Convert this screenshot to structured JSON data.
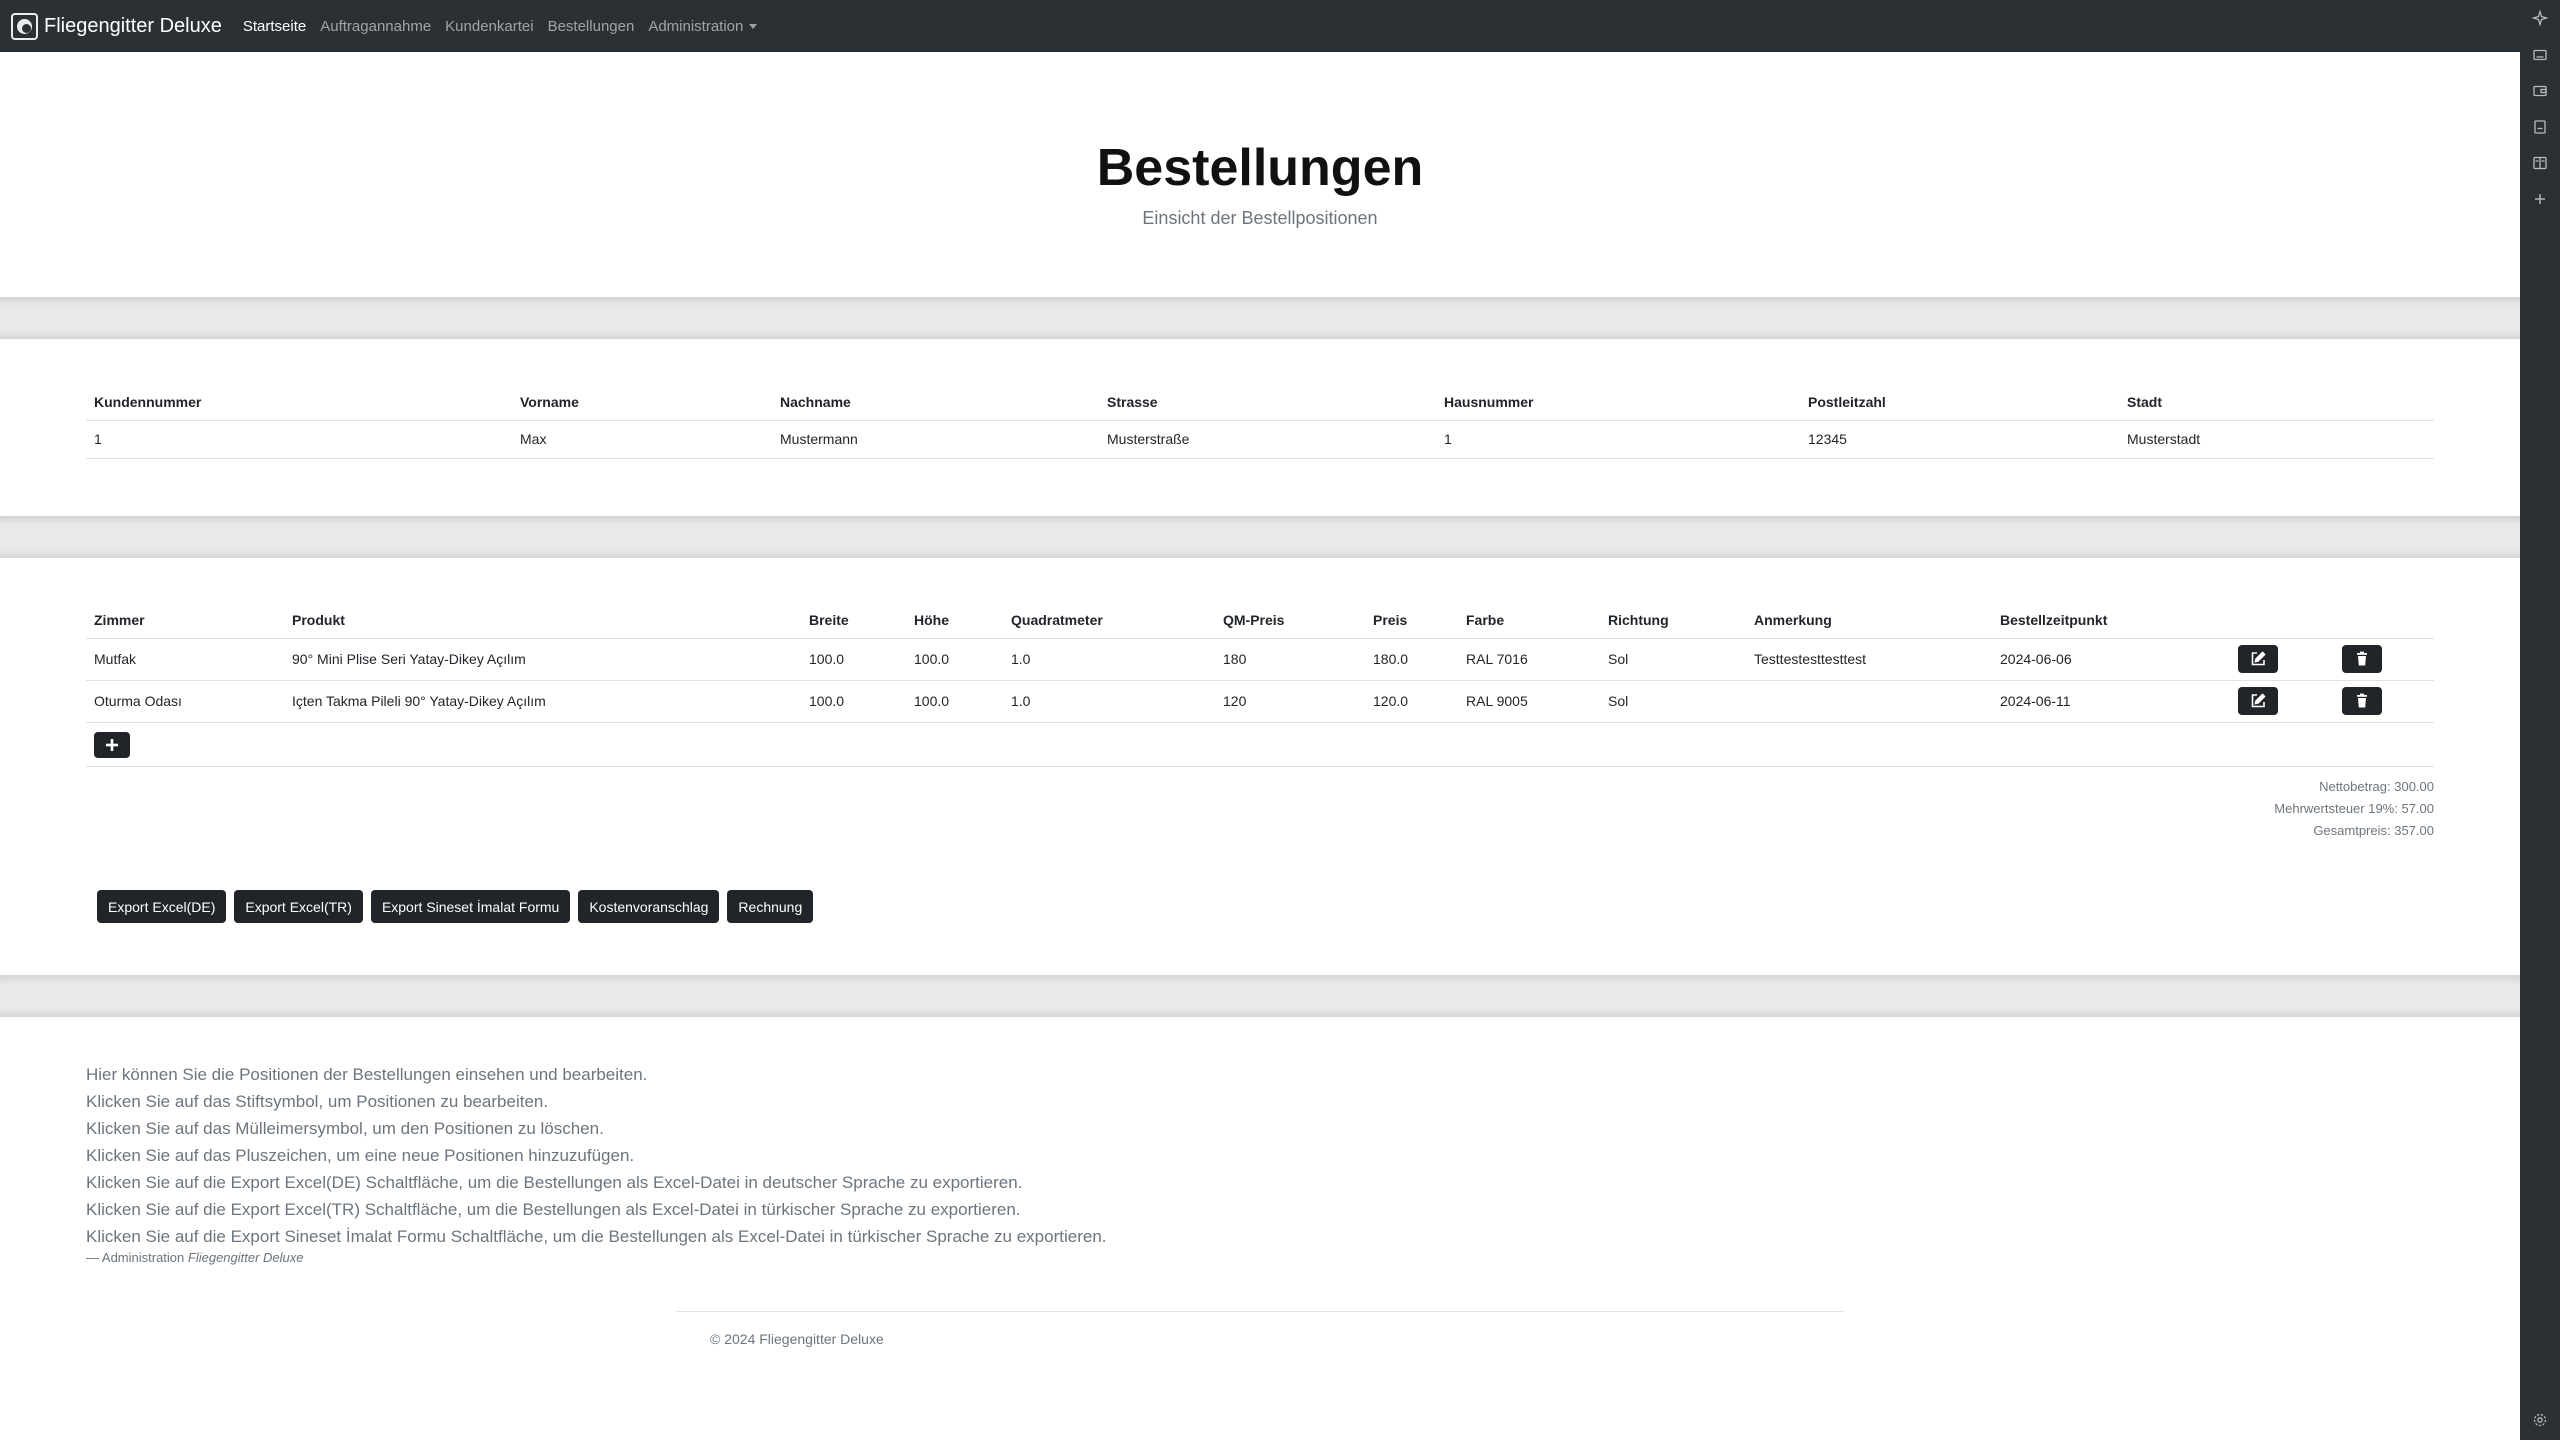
{
  "navbar": {
    "brand": "Fliegengitter Deluxe",
    "items": [
      {
        "label": "Startseite"
      },
      {
        "label": "Auftragannahme"
      },
      {
        "label": "Kundenkartei"
      },
      {
        "label": "Bestellungen"
      },
      {
        "label": "Administration"
      }
    ]
  },
  "header": {
    "title": "Bestellungen",
    "subtitle": "Einsicht der Bestellpositionen"
  },
  "customer_table": {
    "headers": [
      "Kundennummer",
      "Vorname",
      "Nachname",
      "Strasse",
      "Hausnummer",
      "Postleitzahl",
      "Stadt"
    ],
    "row": [
      "1",
      "Max",
      "Mustermann",
      "Musterstraße",
      "1",
      "12345",
      "Musterstadt"
    ]
  },
  "positions_table": {
    "headers": [
      "Zimmer",
      "Produkt",
      "Breite",
      "Höhe",
      "Quadratmeter",
      "QM-Preis",
      "Preis",
      "Farbe",
      "Richtung",
      "Anmerkung",
      "Bestellzeitpunkt"
    ],
    "rows": [
      [
        "Mutfak",
        "90° Mini Plise Seri Yatay-Dikey Açılım",
        "100.0",
        "100.0",
        "1.0",
        "180",
        "180.0",
        "RAL 7016",
        "Sol",
        "Testtestesttesttest",
        "2024-06-06"
      ],
      [
        "Oturma Odası",
        "Içten Takma Pileli 90° Yatay-Dikey Açılım",
        "100.0",
        "100.0",
        "1.0",
        "120",
        "120.0",
        "RAL 9005",
        "Sol",
        "",
        "2024-06-11"
      ]
    ]
  },
  "totals": {
    "net": "Nettobetrag: 300.00",
    "vat": "Mehrwertsteuer 19%: 57.00",
    "gross": "Gesamtpreis: 357.00"
  },
  "actions": [
    "Export Excel(DE)",
    "Export Excel(TR)",
    "Export Sineset İmalat Formu",
    "Kostenvoranschlag",
    "Rechnung"
  ],
  "help": {
    "lines": [
      "Hier können Sie die Positionen der Bestellungen einsehen und bearbeiten.",
      "Klicken Sie auf das Stiftsymbol, um Positionen zu bearbeiten.",
      "Klicken Sie auf das Mülleimersymbol, um den Positionen zu löschen.",
      "Klicken Sie auf das Pluszeichen, um eine neue Positionen hinzuzufügen.",
      "Klicken Sie auf die Export Excel(DE) Schaltfläche, um die Bestellungen als Excel-Datei in deutscher Sprache zu exportieren.",
      "Klicken Sie auf die Export Excel(TR) Schaltfläche, um die Bestellungen als Excel-Datei in türkischer Sprache zu exportieren.",
      "Klicken Sie auf die Export Sineset İmalat Formu Schaltfläche, um die Bestellungen als Excel-Datei in türkischer Sprache zu exportieren."
    ],
    "signature_prefix": "— Administration",
    "signature_cite": "Fliegengitter Deluxe"
  },
  "footer": {
    "text": "© 2024 Fliegengitter Deluxe"
  }
}
